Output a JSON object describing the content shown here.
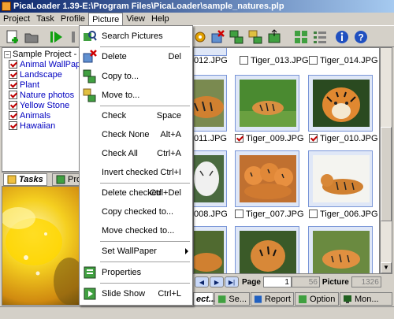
{
  "titlebar": {
    "title": "PicaLoader 1.39-E:\\Program Files\\PicaLoader\\sample_natures.plp"
  },
  "menubar": {
    "items": [
      "Project",
      "Task",
      "Profile",
      "Picture",
      "View",
      "Help"
    ]
  },
  "tree": {
    "root": "Sample Project - Nat",
    "items": [
      {
        "label": "Animal WallPaper",
        "checked": true
      },
      {
        "label": "Landscape",
        "checked": true
      },
      {
        "label": "Plant",
        "checked": true
      },
      {
        "label": "Nature photos",
        "checked": true
      },
      {
        "label": "Yellow Stone",
        "checked": true
      },
      {
        "label": "Animals",
        "checked": true
      },
      {
        "label": "Hawaiian",
        "checked": true
      }
    ]
  },
  "left_tabs": [
    "Tasks",
    "Pro"
  ],
  "picture_menu": {
    "items": [
      {
        "label": "Search Pictures",
        "shortcut": "",
        "icon": "search-pictures-icon"
      },
      {
        "label": "Delete",
        "shortcut": "Del",
        "icon": "delete-icon"
      },
      {
        "label": "Copy to...",
        "shortcut": "",
        "icon": "copy-icon"
      },
      {
        "label": "Move to...",
        "shortcut": "",
        "icon": "move-icon"
      },
      {
        "label": "Check",
        "shortcut": "Space",
        "icon": ""
      },
      {
        "label": "Check None",
        "shortcut": "Alt+A",
        "icon": ""
      },
      {
        "label": "Check All",
        "shortcut": "Ctrl+A",
        "icon": ""
      },
      {
        "label": "Invert checked",
        "shortcut": "Ctrl+I",
        "icon": ""
      },
      {
        "label": "Delete checked",
        "shortcut": "Ctrl+Del",
        "icon": ""
      },
      {
        "label": "Copy checked to...",
        "shortcut": "",
        "icon": ""
      },
      {
        "label": "Move checked to...",
        "shortcut": "",
        "icon": ""
      },
      {
        "label": "Set WallPaper",
        "shortcut": "",
        "icon": ""
      },
      {
        "label": "Properties",
        "shortcut": "",
        "icon": "properties-icon"
      },
      {
        "label": "Slide Show",
        "shortcut": "Ctrl+L",
        "icon": "slideshow-icon"
      }
    ]
  },
  "grid": {
    "row0": [
      {
        "caption": "012.JPG",
        "checkbox": false,
        "checked": false
      },
      {
        "caption": "Tiger_013.JPG",
        "checkbox": true,
        "checked": false
      },
      {
        "caption": "Tiger_014.JPG",
        "checkbox": true,
        "checked": false
      }
    ],
    "row1": [
      {
        "caption": "011.JPG",
        "checkbox": false,
        "checked": false
      },
      {
        "caption": "Tiger_009.JPG",
        "checkbox": true,
        "checked": true
      },
      {
        "caption": "Tiger_010.JPG",
        "checkbox": true,
        "checked": true
      }
    ],
    "row2": [
      {
        "caption": "008.JPG",
        "checkbox": false,
        "checked": false
      },
      {
        "caption": "Tiger_007.JPG",
        "checkbox": true,
        "checked": false
      },
      {
        "caption": "Tiger_006.JPG",
        "checkbox": true,
        "checked": false
      }
    ]
  },
  "pager": {
    "page_label": "Page",
    "page_value": "1",
    "total_pages": "56",
    "picture_label": "Picture",
    "picture_count": "1326"
  },
  "bottom_tabs": [
    "ect...",
    "Se...",
    "Report",
    "Option",
    "Mon..."
  ],
  "colors": {
    "title_start": "#0a246a",
    "title_end": "#a6caf0",
    "check_red": "#c00000",
    "tree_link": "#0000c0"
  }
}
